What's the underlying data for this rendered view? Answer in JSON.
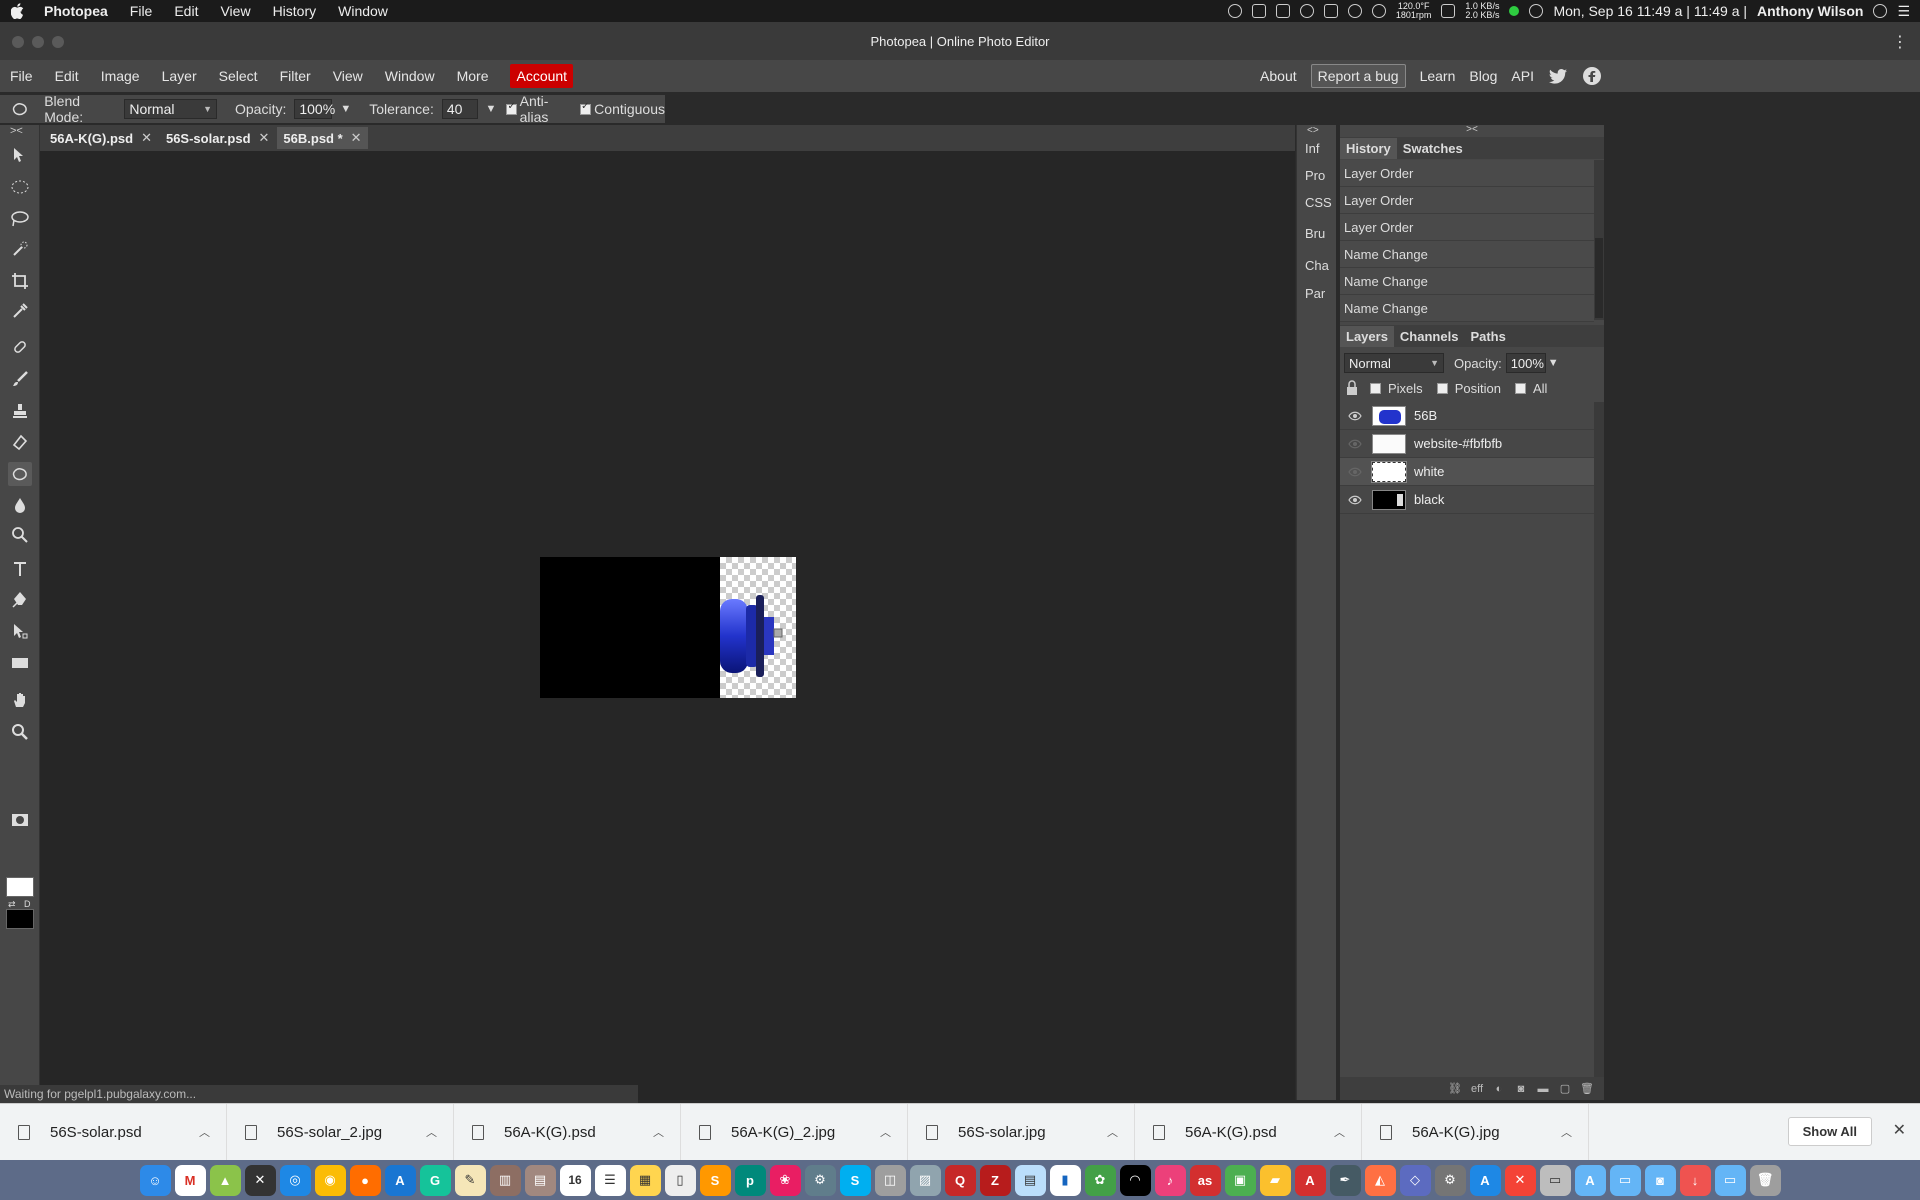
{
  "mac_menubar": {
    "app": "Photopea",
    "items": [
      "File",
      "Edit",
      "View",
      "History",
      "Window"
    ],
    "temp": "120.0°F",
    "rpm": "1801rpm",
    "net_up": "1.0 KB/s",
    "net_down": "2.0 KB/s",
    "clock": "Mon, Sep 16 11:49 a | 11:49 a |",
    "user": "Anthony Wilson"
  },
  "window": {
    "title": "Photopea | Online Photo Editor"
  },
  "pp_menu": {
    "items": [
      "File",
      "Edit",
      "Image",
      "Layer",
      "Select",
      "Filter",
      "View",
      "Window",
      "More"
    ],
    "account": "Account",
    "right": {
      "about": "About",
      "bug": "Report a bug",
      "learn": "Learn",
      "blog": "Blog",
      "api": "API"
    }
  },
  "options": {
    "blend_label": "Blend Mode:",
    "blend_value": "Normal",
    "opacity_label": "Opacity:",
    "opacity_value": "100%",
    "tolerance_label": "Tolerance:",
    "tolerance_value": "40",
    "antialias": "Anti-alias",
    "contiguous": "Contiguous"
  },
  "tabs": [
    {
      "label": "56A-K(G).psd"
    },
    {
      "label": "56S-solar.psd"
    },
    {
      "label": "56B.psd *"
    }
  ],
  "status": "Waiting for pgelpl1.pubgalaxy.com...",
  "mini_panels": [
    "Inf",
    "Pro",
    "CSS",
    "Bru",
    "Cha",
    "Par"
  ],
  "history": {
    "tabs": [
      "History",
      "Swatches"
    ],
    "items": [
      "Layer Order",
      "Layer Order",
      "Layer Order",
      "Name Change",
      "Name Change",
      "Name Change"
    ]
  },
  "layers": {
    "tabs": [
      "Layers",
      "Channels",
      "Paths"
    ],
    "blend": "Normal",
    "opacity_label": "Opacity:",
    "opacity_value": "100%",
    "lock_pixels": "Pixels",
    "lock_position": "Position",
    "lock_all": "All",
    "items": [
      {
        "name": "56B"
      },
      {
        "name": "website-#fbfbfb"
      },
      {
        "name": "white"
      },
      {
        "name": "black"
      }
    ],
    "footer_eff": "eff"
  },
  "downloads": {
    "items": [
      "56S-solar.psd",
      "56S-solar_2.jpg",
      "56A-K(G).psd",
      "56A-K(G)_2.jpg",
      "56S-solar.jpg",
      "56A-K(G).psd",
      "56A-K(G).jpg"
    ],
    "show_all": "Show All"
  },
  "dock": {
    "calendar_day": "16"
  },
  "colors": {
    "accent_account": "#cc0000",
    "foreground": "#ffffff",
    "background": "#000000"
  }
}
